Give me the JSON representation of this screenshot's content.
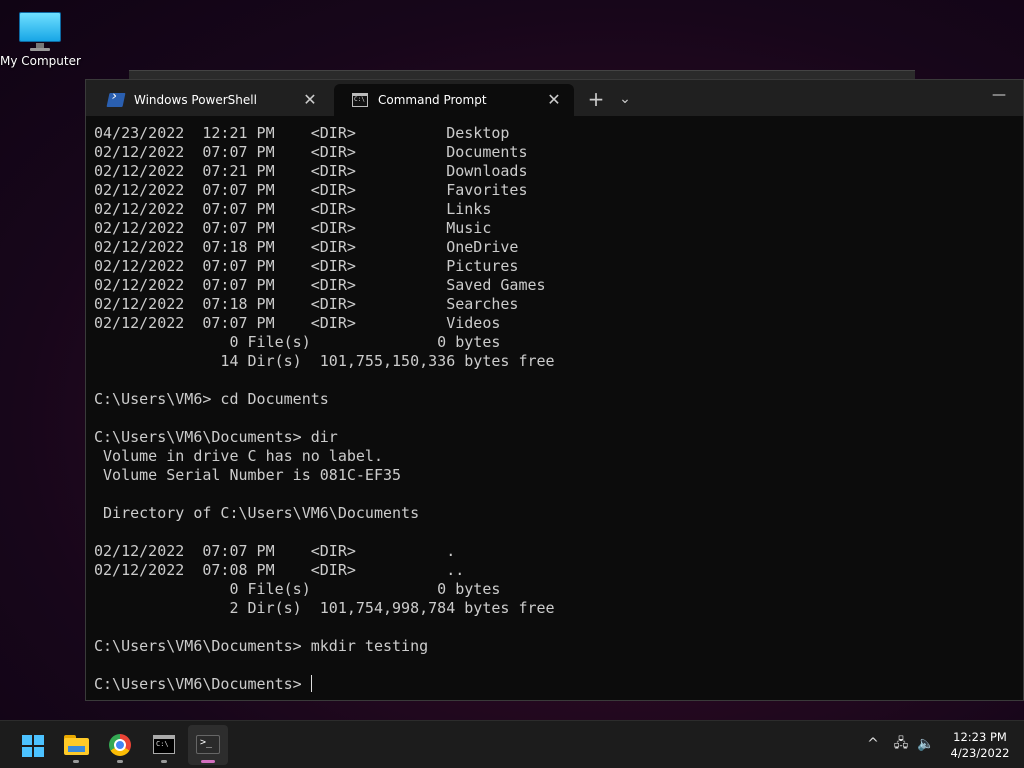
{
  "desktop": {
    "icons": [
      {
        "label": "My Computer",
        "icon": "monitor-icon"
      }
    ]
  },
  "terminal": {
    "tabs": [
      {
        "label": "Windows PowerShell",
        "icon": "powershell-icon",
        "active": false
      },
      {
        "label": "Command Prompt",
        "icon": "cmd-icon",
        "active": true
      }
    ],
    "new_tab": "+",
    "dropdown": "⌄",
    "minimize": "—",
    "lines": [
      "04/23/2022  12:21 PM    <DIR>          Desktop",
      "02/12/2022  07:07 PM    <DIR>          Documents",
      "02/12/2022  07:21 PM    <DIR>          Downloads",
      "02/12/2022  07:07 PM    <DIR>          Favorites",
      "02/12/2022  07:07 PM    <DIR>          Links",
      "02/12/2022  07:07 PM    <DIR>          Music",
      "02/12/2022  07:18 PM    <DIR>          OneDrive",
      "02/12/2022  07:07 PM    <DIR>          Pictures",
      "02/12/2022  07:07 PM    <DIR>          Saved Games",
      "02/12/2022  07:18 PM    <DIR>          Searches",
      "02/12/2022  07:07 PM    <DIR>          Videos",
      "               0 File(s)              0 bytes",
      "              14 Dir(s)  101,755,150,336 bytes free",
      "",
      "C:\\Users\\VM6> cd Documents",
      "",
      "C:\\Users\\VM6\\Documents> dir",
      " Volume in drive C has no label.",
      " Volume Serial Number is 081C-EF35",
      "",
      " Directory of C:\\Users\\VM6\\Documents",
      "",
      "02/12/2022  07:07 PM    <DIR>          .",
      "02/12/2022  07:08 PM    <DIR>          ..",
      "               0 File(s)              0 bytes",
      "               2 Dir(s)  101,754,998,784 bytes free",
      "",
      "C:\\Users\\VM6\\Documents> mkdir testing",
      ""
    ],
    "prompt": "C:\\Users\\VM6\\Documents> "
  },
  "taskbar": {
    "apps": [
      {
        "name": "start",
        "icon": "windows-logo-icon"
      },
      {
        "name": "file-explorer",
        "icon": "folder-icon"
      },
      {
        "name": "chrome",
        "icon": "chrome-icon"
      },
      {
        "name": "command-prompt",
        "icon": "cmd-icon"
      },
      {
        "name": "windows-terminal",
        "icon": "terminal-icon",
        "active": true
      }
    ],
    "tray": {
      "chevron": "^",
      "network_icon": "network-icon",
      "volume_icon": "volume-icon"
    },
    "time": "12:23 PM",
    "date": "4/23/2022"
  }
}
